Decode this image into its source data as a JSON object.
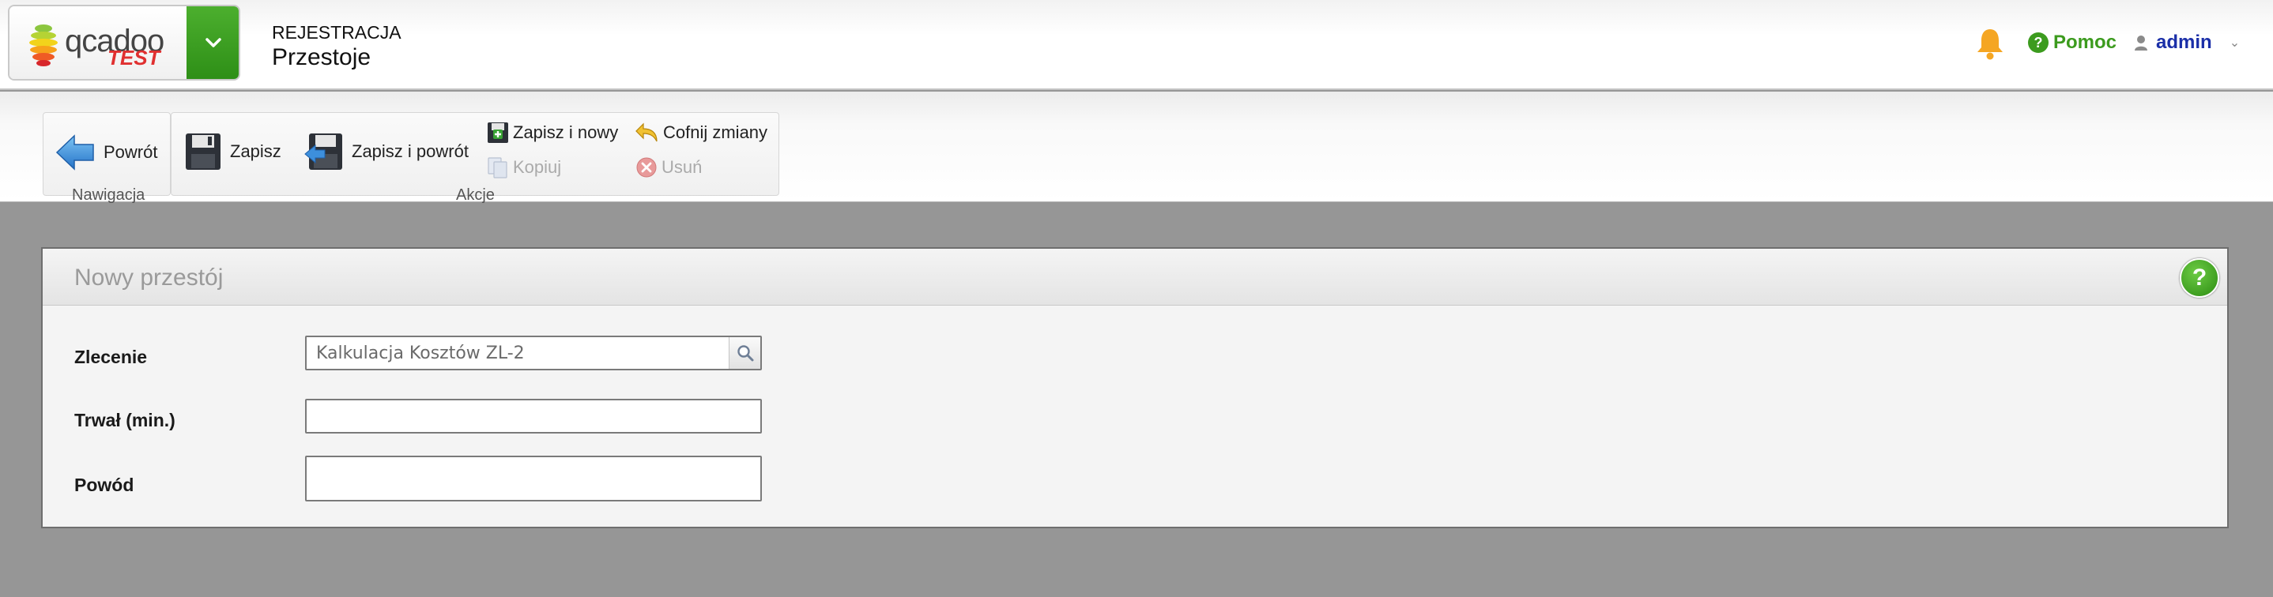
{
  "header": {
    "logo_text": "qcadoo",
    "logo_tag": "TEST",
    "breadcrumb_section": "REJESTRACJA",
    "breadcrumb_page": "Przestoje",
    "help_label": "Pomoc",
    "user_name": "admin"
  },
  "ribbon": {
    "groups": [
      {
        "label": "Nawigacja"
      },
      {
        "label": "Akcje"
      }
    ],
    "buttons": {
      "back": "Powrót",
      "save": "Zapisz",
      "save_back": "Zapisz i powrót",
      "save_new": "Zapisz i nowy",
      "undo": "Cofnij zmiany",
      "copy": "Kopiuj",
      "delete": "Usuń"
    }
  },
  "form": {
    "title": "Nowy przestój",
    "fields": [
      {
        "label": "Zlecenie",
        "value": "Kalkulacja Kosztów ZL-2"
      },
      {
        "label": "Trwał (min.)",
        "value": ""
      },
      {
        "label": "Powód",
        "value": ""
      }
    ]
  },
  "colors": {
    "accent_green": "#3c9b1e",
    "user_blue": "#1b2fa8",
    "bell_orange": "#f5a623",
    "page_background": "#969696"
  },
  "icons": [
    "chevron-down-icon",
    "bell-icon",
    "help-icon",
    "user-icon",
    "back-arrow-icon",
    "floppy-icon",
    "floppy-arrow-icon",
    "floppy-plus-icon",
    "undo-icon",
    "copy-icon",
    "delete-icon",
    "search-icon"
  ]
}
